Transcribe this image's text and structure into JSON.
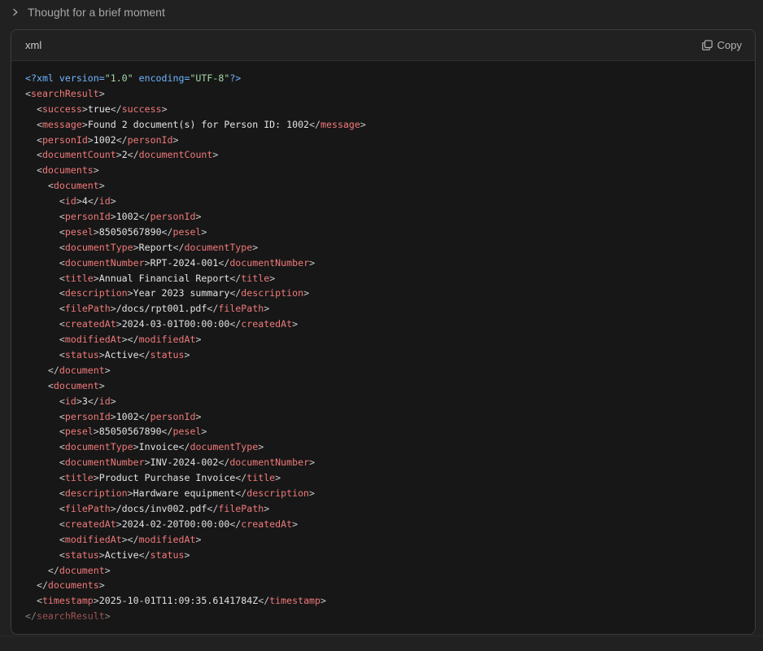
{
  "thought": {
    "label": "Thought for a brief moment",
    "icon": "chevron-right-icon"
  },
  "code_block": {
    "language": "xml",
    "copy_label": "Copy",
    "copy_icon": "copy-icon",
    "lines": [
      [
        {
          "t": "pi",
          "v": "<?xml version="
        },
        {
          "t": "str",
          "v": "\"1.0\""
        },
        {
          "t": "pi",
          "v": " encoding="
        },
        {
          "t": "str",
          "v": "\"UTF-8\""
        },
        {
          "t": "pi",
          "v": "?>"
        }
      ],
      [
        {
          "t": "bk",
          "v": "<"
        },
        {
          "t": "tg",
          "v": "searchResult"
        },
        {
          "t": "bk",
          "v": ">"
        }
      ],
      [
        {
          "t": "bk",
          "v": "  <"
        },
        {
          "t": "tg",
          "v": "success"
        },
        {
          "t": "bk",
          "v": ">"
        },
        {
          "t": "tx",
          "v": "true"
        },
        {
          "t": "bk",
          "v": "</"
        },
        {
          "t": "tg",
          "v": "success"
        },
        {
          "t": "bk",
          "v": ">"
        }
      ],
      [
        {
          "t": "bk",
          "v": "  <"
        },
        {
          "t": "tg",
          "v": "message"
        },
        {
          "t": "bk",
          "v": ">"
        },
        {
          "t": "tx",
          "v": "Found 2 document(s) for Person ID: 1002"
        },
        {
          "t": "bk",
          "v": "</"
        },
        {
          "t": "tg",
          "v": "message"
        },
        {
          "t": "bk",
          "v": ">"
        }
      ],
      [
        {
          "t": "bk",
          "v": "  <"
        },
        {
          "t": "tg",
          "v": "personId"
        },
        {
          "t": "bk",
          "v": ">"
        },
        {
          "t": "tx",
          "v": "1002"
        },
        {
          "t": "bk",
          "v": "</"
        },
        {
          "t": "tg",
          "v": "personId"
        },
        {
          "t": "bk",
          "v": ">"
        }
      ],
      [
        {
          "t": "bk",
          "v": "  <"
        },
        {
          "t": "tg",
          "v": "documentCount"
        },
        {
          "t": "bk",
          "v": ">"
        },
        {
          "t": "tx",
          "v": "2"
        },
        {
          "t": "bk",
          "v": "</"
        },
        {
          "t": "tg",
          "v": "documentCount"
        },
        {
          "t": "bk",
          "v": ">"
        }
      ],
      [
        {
          "t": "bk",
          "v": "  <"
        },
        {
          "t": "tg",
          "v": "documents"
        },
        {
          "t": "bk",
          "v": ">"
        }
      ],
      [
        {
          "t": "bk",
          "v": "    <"
        },
        {
          "t": "tg",
          "v": "document"
        },
        {
          "t": "bk",
          "v": ">"
        }
      ],
      [
        {
          "t": "bk",
          "v": "      <"
        },
        {
          "t": "tg",
          "v": "id"
        },
        {
          "t": "bk",
          "v": ">"
        },
        {
          "t": "tx",
          "v": "4"
        },
        {
          "t": "bk",
          "v": "</"
        },
        {
          "t": "tg",
          "v": "id"
        },
        {
          "t": "bk",
          "v": ">"
        }
      ],
      [
        {
          "t": "bk",
          "v": "      <"
        },
        {
          "t": "tg",
          "v": "personId"
        },
        {
          "t": "bk",
          "v": ">"
        },
        {
          "t": "tx",
          "v": "1002"
        },
        {
          "t": "bk",
          "v": "</"
        },
        {
          "t": "tg",
          "v": "personId"
        },
        {
          "t": "bk",
          "v": ">"
        }
      ],
      [
        {
          "t": "bk",
          "v": "      <"
        },
        {
          "t": "tg",
          "v": "pesel"
        },
        {
          "t": "bk",
          "v": ">"
        },
        {
          "t": "tx",
          "v": "85050567890"
        },
        {
          "t": "bk",
          "v": "</"
        },
        {
          "t": "tg",
          "v": "pesel"
        },
        {
          "t": "bk",
          "v": ">"
        }
      ],
      [
        {
          "t": "bk",
          "v": "      <"
        },
        {
          "t": "tg",
          "v": "documentType"
        },
        {
          "t": "bk",
          "v": ">"
        },
        {
          "t": "tx",
          "v": "Report"
        },
        {
          "t": "bk",
          "v": "</"
        },
        {
          "t": "tg",
          "v": "documentType"
        },
        {
          "t": "bk",
          "v": ">"
        }
      ],
      [
        {
          "t": "bk",
          "v": "      <"
        },
        {
          "t": "tg",
          "v": "documentNumber"
        },
        {
          "t": "bk",
          "v": ">"
        },
        {
          "t": "tx",
          "v": "RPT-2024-001"
        },
        {
          "t": "bk",
          "v": "</"
        },
        {
          "t": "tg",
          "v": "documentNumber"
        },
        {
          "t": "bk",
          "v": ">"
        }
      ],
      [
        {
          "t": "bk",
          "v": "      <"
        },
        {
          "t": "tg",
          "v": "title"
        },
        {
          "t": "bk",
          "v": ">"
        },
        {
          "t": "tx",
          "v": "Annual Financial Report"
        },
        {
          "t": "bk",
          "v": "</"
        },
        {
          "t": "tg",
          "v": "title"
        },
        {
          "t": "bk",
          "v": ">"
        }
      ],
      [
        {
          "t": "bk",
          "v": "      <"
        },
        {
          "t": "tg",
          "v": "description"
        },
        {
          "t": "bk",
          "v": ">"
        },
        {
          "t": "tx",
          "v": "Year 2023 summary"
        },
        {
          "t": "bk",
          "v": "</"
        },
        {
          "t": "tg",
          "v": "description"
        },
        {
          "t": "bk",
          "v": ">"
        }
      ],
      [
        {
          "t": "bk",
          "v": "      <"
        },
        {
          "t": "tg",
          "v": "filePath"
        },
        {
          "t": "bk",
          "v": ">"
        },
        {
          "t": "tx",
          "v": "/docs/rpt001.pdf"
        },
        {
          "t": "bk",
          "v": "</"
        },
        {
          "t": "tg",
          "v": "filePath"
        },
        {
          "t": "bk",
          "v": ">"
        }
      ],
      [
        {
          "t": "bk",
          "v": "      <"
        },
        {
          "t": "tg",
          "v": "createdAt"
        },
        {
          "t": "bk",
          "v": ">"
        },
        {
          "t": "tx",
          "v": "2024-03-01T00:00:00"
        },
        {
          "t": "bk",
          "v": "</"
        },
        {
          "t": "tg",
          "v": "createdAt"
        },
        {
          "t": "bk",
          "v": ">"
        }
      ],
      [
        {
          "t": "bk",
          "v": "      <"
        },
        {
          "t": "tg",
          "v": "modifiedAt"
        },
        {
          "t": "bk",
          "v": "></"
        },
        {
          "t": "tg",
          "v": "modifiedAt"
        },
        {
          "t": "bk",
          "v": ">"
        }
      ],
      [
        {
          "t": "bk",
          "v": "      <"
        },
        {
          "t": "tg",
          "v": "status"
        },
        {
          "t": "bk",
          "v": ">"
        },
        {
          "t": "tx",
          "v": "Active"
        },
        {
          "t": "bk",
          "v": "</"
        },
        {
          "t": "tg",
          "v": "status"
        },
        {
          "t": "bk",
          "v": ">"
        }
      ],
      [
        {
          "t": "bk",
          "v": "    </"
        },
        {
          "t": "tg",
          "v": "document"
        },
        {
          "t": "bk",
          "v": ">"
        }
      ],
      [
        {
          "t": "bk",
          "v": "    <"
        },
        {
          "t": "tg",
          "v": "document"
        },
        {
          "t": "bk",
          "v": ">"
        }
      ],
      [
        {
          "t": "bk",
          "v": "      <"
        },
        {
          "t": "tg",
          "v": "id"
        },
        {
          "t": "bk",
          "v": ">"
        },
        {
          "t": "tx",
          "v": "3"
        },
        {
          "t": "bk",
          "v": "</"
        },
        {
          "t": "tg",
          "v": "id"
        },
        {
          "t": "bk",
          "v": ">"
        }
      ],
      [
        {
          "t": "bk",
          "v": "      <"
        },
        {
          "t": "tg",
          "v": "personId"
        },
        {
          "t": "bk",
          "v": ">"
        },
        {
          "t": "tx",
          "v": "1002"
        },
        {
          "t": "bk",
          "v": "</"
        },
        {
          "t": "tg",
          "v": "personId"
        },
        {
          "t": "bk",
          "v": ">"
        }
      ],
      [
        {
          "t": "bk",
          "v": "      <"
        },
        {
          "t": "tg",
          "v": "pesel"
        },
        {
          "t": "bk",
          "v": ">"
        },
        {
          "t": "tx",
          "v": "85050567890"
        },
        {
          "t": "bk",
          "v": "</"
        },
        {
          "t": "tg",
          "v": "pesel"
        },
        {
          "t": "bk",
          "v": ">"
        }
      ],
      [
        {
          "t": "bk",
          "v": "      <"
        },
        {
          "t": "tg",
          "v": "documentType"
        },
        {
          "t": "bk",
          "v": ">"
        },
        {
          "t": "tx",
          "v": "Invoice"
        },
        {
          "t": "bk",
          "v": "</"
        },
        {
          "t": "tg",
          "v": "documentType"
        },
        {
          "t": "bk",
          "v": ">"
        }
      ],
      [
        {
          "t": "bk",
          "v": "      <"
        },
        {
          "t": "tg",
          "v": "documentNumber"
        },
        {
          "t": "bk",
          "v": ">"
        },
        {
          "t": "tx",
          "v": "INV-2024-002"
        },
        {
          "t": "bk",
          "v": "</"
        },
        {
          "t": "tg",
          "v": "documentNumber"
        },
        {
          "t": "bk",
          "v": ">"
        }
      ],
      [
        {
          "t": "bk",
          "v": "      <"
        },
        {
          "t": "tg",
          "v": "title"
        },
        {
          "t": "bk",
          "v": ">"
        },
        {
          "t": "tx",
          "v": "Product Purchase Invoice"
        },
        {
          "t": "bk",
          "v": "</"
        },
        {
          "t": "tg",
          "v": "title"
        },
        {
          "t": "bk",
          "v": ">"
        }
      ],
      [
        {
          "t": "bk",
          "v": "      <"
        },
        {
          "t": "tg",
          "v": "description"
        },
        {
          "t": "bk",
          "v": ">"
        },
        {
          "t": "tx",
          "v": "Hardware equipment"
        },
        {
          "t": "bk",
          "v": "</"
        },
        {
          "t": "tg",
          "v": "description"
        },
        {
          "t": "bk",
          "v": ">"
        }
      ],
      [
        {
          "t": "bk",
          "v": "      <"
        },
        {
          "t": "tg",
          "v": "filePath"
        },
        {
          "t": "bk",
          "v": ">"
        },
        {
          "t": "tx",
          "v": "/docs/inv002.pdf"
        },
        {
          "t": "bk",
          "v": "</"
        },
        {
          "t": "tg",
          "v": "filePath"
        },
        {
          "t": "bk",
          "v": ">"
        }
      ],
      [
        {
          "t": "bk",
          "v": "      <"
        },
        {
          "t": "tg",
          "v": "createdAt"
        },
        {
          "t": "bk",
          "v": ">"
        },
        {
          "t": "tx",
          "v": "2024-02-20T00:00:00"
        },
        {
          "t": "bk",
          "v": "</"
        },
        {
          "t": "tg",
          "v": "createdAt"
        },
        {
          "t": "bk",
          "v": ">"
        }
      ],
      [
        {
          "t": "bk",
          "v": "      <"
        },
        {
          "t": "tg",
          "v": "modifiedAt"
        },
        {
          "t": "bk",
          "v": "></"
        },
        {
          "t": "tg",
          "v": "modifiedAt"
        },
        {
          "t": "bk",
          "v": ">"
        }
      ],
      [
        {
          "t": "bk",
          "v": "      <"
        },
        {
          "t": "tg",
          "v": "status"
        },
        {
          "t": "bk",
          "v": ">"
        },
        {
          "t": "tx",
          "v": "Active"
        },
        {
          "t": "bk",
          "v": "</"
        },
        {
          "t": "tg",
          "v": "status"
        },
        {
          "t": "bk",
          "v": ">"
        }
      ],
      [
        {
          "t": "bk",
          "v": "    </"
        },
        {
          "t": "tg",
          "v": "document"
        },
        {
          "t": "bk",
          "v": ">"
        }
      ],
      [
        {
          "t": "bk",
          "v": "  </"
        },
        {
          "t": "tg",
          "v": "documents"
        },
        {
          "t": "bk",
          "v": ">"
        }
      ],
      [
        {
          "t": "bk",
          "v": "  <"
        },
        {
          "t": "tg",
          "v": "timestamp"
        },
        {
          "t": "bk",
          "v": ">"
        },
        {
          "t": "tx",
          "v": "2025-10-01T11:09:35.6141784Z"
        },
        {
          "t": "bk",
          "v": "</"
        },
        {
          "t": "tg",
          "v": "timestamp"
        },
        {
          "t": "bk",
          "v": ">"
        }
      ],
      [
        {
          "t": "bk",
          "v": "</"
        },
        {
          "t": "tg",
          "v": "searchResult"
        },
        {
          "t": "bk",
          "v": ">"
        }
      ]
    ]
  },
  "colors": {
    "page_bg": "#212121",
    "code_bg": "#171717",
    "tag": "#f2797a",
    "pi": "#6fb6ff",
    "string": "#a5d6a7",
    "text": "#e3e3e3"
  }
}
